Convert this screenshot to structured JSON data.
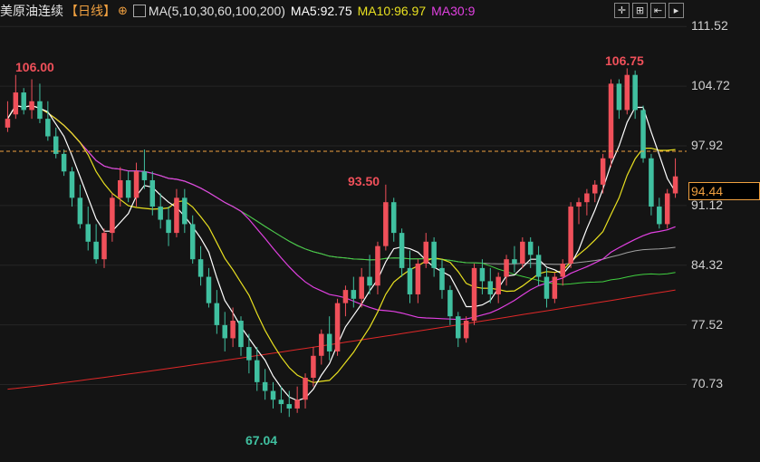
{
  "header": {
    "title": "美原油连续",
    "period": "【日线】",
    "ma_label": "MA(5,10,30,60,100,200)",
    "ma5": "MA5:92.75",
    "ma10": "MA10:96.97",
    "ma30": "MA30:9"
  },
  "colors": {
    "up": "#f0505a",
    "down": "#40c0a0",
    "ma5": "#ffffff",
    "ma10": "#e8e020",
    "ma30": "#e040e0",
    "ma60": "#40d040",
    "ma100": "#a0a0a0",
    "ma200": "#e02828",
    "current": "#f0a040"
  },
  "chart_data": {
    "type": "candlestick",
    "ylim": [
      65.0,
      113.5
    ],
    "yticks": [
      "111.52",
      "104.72",
      "97.92",
      "91.12",
      "84.32",
      "77.52",
      "70.73"
    ],
    "current_price": "94.44",
    "annotations": {
      "high_left": "106.00",
      "mid": "93.50",
      "low": "67.04",
      "high_right": "106.75"
    },
    "candles": [
      [
        100,
        103,
        99.5,
        101
      ],
      [
        101.5,
        106,
        101,
        104
      ],
      [
        104,
        104.5,
        101.5,
        102
      ],
      [
        102,
        105.5,
        101,
        103
      ],
      [
        103,
        105,
        100.5,
        101
      ],
      [
        101,
        103,
        98.5,
        99
      ],
      [
        99,
        100,
        96.5,
        97
      ],
      [
        97,
        97.5,
        94.5,
        95
      ],
      [
        95,
        95.5,
        91,
        92
      ],
      [
        92,
        93.5,
        88.5,
        89
      ],
      [
        89,
        91,
        86,
        87
      ],
      [
        87,
        89,
        84.5,
        85
      ],
      [
        85,
        88.5,
        84,
        88
      ],
      [
        88,
        92.5,
        87,
        92
      ],
      [
        92,
        95.5,
        91,
        94
      ],
      [
        94,
        95,
        91.5,
        92
      ],
      [
        92,
        96,
        91,
        95
      ],
      [
        95,
        97.5,
        93,
        94
      ],
      [
        94,
        95,
        90,
        91
      ],
      [
        91,
        92.5,
        88.5,
        89.5
      ],
      [
        89.5,
        91,
        86.5,
        88
      ],
      [
        88,
        93,
        87.5,
        92
      ],
      [
        92,
        93,
        88,
        89
      ],
      [
        89,
        90,
        84.5,
        85
      ],
      [
        85,
        86.5,
        82,
        83
      ],
      [
        83,
        84,
        79.5,
        80
      ],
      [
        80,
        81.5,
        76.5,
        77.5
      ],
      [
        77.5,
        79,
        74.5,
        76
      ],
      [
        76,
        79.5,
        75,
        78
      ],
      [
        78,
        78.5,
        74,
        75
      ],
      [
        75,
        76.5,
        72,
        73.5
      ],
      [
        73.5,
        75,
        70,
        71
      ],
      [
        71,
        72.5,
        69,
        70
      ],
      [
        70,
        71,
        68,
        69
      ],
      [
        69,
        70.5,
        67.5,
        68.5
      ],
      [
        68.5,
        70,
        67.04,
        68
      ],
      [
        68,
        70.5,
        67.5,
        69
      ],
      [
        69,
        72,
        68,
        71.5
      ],
      [
        71.5,
        75,
        70.5,
        74
      ],
      [
        74,
        77,
        73,
        76.5
      ],
      [
        76.5,
        78.5,
        73.5,
        74.5
      ],
      [
        74.5,
        80.5,
        74,
        80
      ],
      [
        80,
        82,
        78.5,
        81.5
      ],
      [
        81.5,
        83,
        79.5,
        80.5
      ],
      [
        80.5,
        84,
        79.5,
        83
      ],
      [
        83,
        85.5,
        81,
        82
      ],
      [
        82,
        87,
        81,
        86.5
      ],
      [
        86.5,
        93.5,
        86,
        91.5
      ],
      [
        91.5,
        92,
        87,
        88
      ],
      [
        88,
        88.5,
        83,
        84
      ],
      [
        84,
        86,
        80,
        81
      ],
      [
        81,
        85,
        80,
        84.5
      ],
      [
        84.5,
        88,
        84,
        87
      ],
      [
        87,
        87.5,
        83,
        84
      ],
      [
        84,
        85,
        80.5,
        81.5
      ],
      [
        81.5,
        82,
        77.5,
        78.5
      ],
      [
        78.5,
        79,
        75,
        76
      ],
      [
        76,
        78.5,
        75.5,
        78
      ],
      [
        78,
        84.5,
        77.5,
        84
      ],
      [
        84,
        85,
        81,
        82.5
      ],
      [
        82.5,
        84,
        80,
        81
      ],
      [
        81,
        83.5,
        80,
        83
      ],
      [
        83,
        85.5,
        82,
        85
      ],
      [
        85,
        86.5,
        83.5,
        84.5
      ],
      [
        84.5,
        87.5,
        84,
        87
      ],
      [
        87,
        87.5,
        84,
        85.5
      ],
      [
        85.5,
        86.5,
        82,
        83
      ],
      [
        83,
        84,
        79.5,
        80.5
      ],
      [
        80.5,
        83.5,
        80,
        83
      ],
      [
        83,
        85,
        82,
        84.5
      ],
      [
        84.5,
        91.5,
        84,
        91
      ],
      [
        91,
        92,
        89,
        91.5
      ],
      [
        91.5,
        93,
        90,
        92.5
      ],
      [
        92.5,
        94,
        91.5,
        93.5
      ],
      [
        93.5,
        97,
        92.5,
        96.5
      ],
      [
        96.5,
        105.5,
        95.5,
        105
      ],
      [
        105,
        105.5,
        101,
        102
      ],
      [
        102,
        106.75,
        101.5,
        106
      ],
      [
        106,
        106.5,
        101,
        102
      ],
      [
        102,
        102.5,
        96,
        96.5
      ],
      [
        96.5,
        97,
        90,
        91
      ],
      [
        91,
        92,
        88.5,
        89
      ],
      [
        89,
        93,
        88.5,
        92.5
      ],
      [
        92.5,
        96.5,
        92,
        94.44
      ]
    ]
  }
}
